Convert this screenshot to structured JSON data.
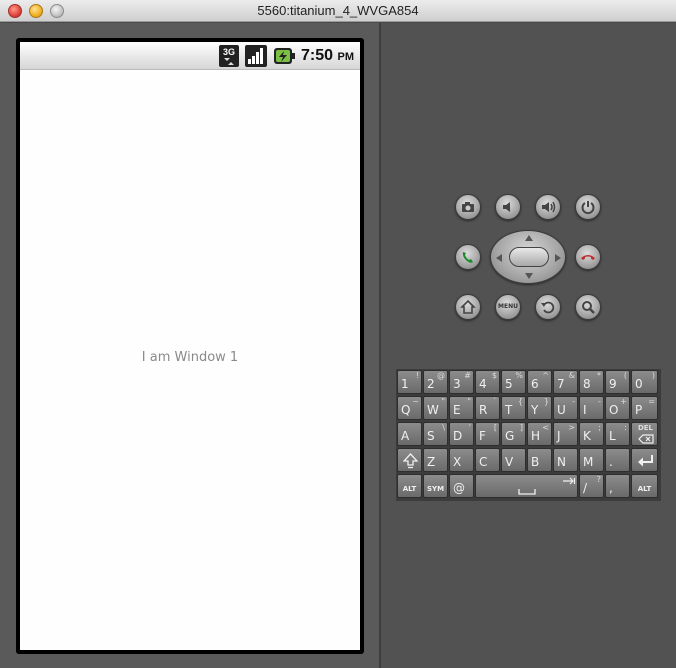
{
  "window": {
    "title": "5560:titanium_4_WVGA854"
  },
  "statusbar": {
    "time": "7:50",
    "ampm": "PM",
    "network": "3G"
  },
  "app": {
    "label": "I am Window 1"
  },
  "controls": {
    "menu_label": "MENU",
    "icons": [
      "camera-icon",
      "volume-down-icon",
      "volume-up-icon",
      "power-icon",
      "call-icon",
      "end-call-icon",
      "home-icon",
      "menu-icon",
      "back-icon",
      "search-icon"
    ]
  },
  "keyboard": {
    "row1": [
      {
        "main": "1",
        "alt": "!"
      },
      {
        "main": "2",
        "alt": "@"
      },
      {
        "main": "3",
        "alt": "#"
      },
      {
        "main": "4",
        "alt": "$"
      },
      {
        "main": "5",
        "alt": "%"
      },
      {
        "main": "6",
        "alt": "^"
      },
      {
        "main": "7",
        "alt": "&"
      },
      {
        "main": "8",
        "alt": "*"
      },
      {
        "main": "9",
        "alt": "("
      },
      {
        "main": "0",
        "alt": ")"
      }
    ],
    "row2": [
      {
        "main": "Q",
        "alt": "~"
      },
      {
        "main": "W",
        "alt": "\""
      },
      {
        "main": "E",
        "alt": "\""
      },
      {
        "main": "R",
        "alt": "`"
      },
      {
        "main": "T",
        "alt": "{"
      },
      {
        "main": "Y",
        "alt": "}"
      },
      {
        "main": "U",
        "alt": "-"
      },
      {
        "main": "I",
        "alt": "-"
      },
      {
        "main": "O",
        "alt": "+"
      },
      {
        "main": "P",
        "alt": "="
      }
    ],
    "row3": [
      {
        "main": "A",
        "alt": ""
      },
      {
        "main": "S",
        "alt": "\\"
      },
      {
        "main": "D",
        "alt": "'"
      },
      {
        "main": "F",
        "alt": "["
      },
      {
        "main": "G",
        "alt": "]"
      },
      {
        "main": "H",
        "alt": "<"
      },
      {
        "main": "J",
        "alt": ">"
      },
      {
        "main": "K",
        "alt": ";"
      },
      {
        "main": "L",
        "alt": ":"
      }
    ],
    "row4": [
      {
        "main": "Z",
        "alt": ""
      },
      {
        "main": "X",
        "alt": ""
      },
      {
        "main": "C",
        "alt": ""
      },
      {
        "main": "V",
        "alt": ""
      },
      {
        "main": "B",
        "alt": ""
      },
      {
        "main": "N",
        "alt": ""
      },
      {
        "main": "M",
        "alt": ""
      },
      {
        "main": ".",
        "alt": ""
      }
    ],
    "del_label": "DEL",
    "alt_label": "ALT",
    "sym_label": "SYM",
    "at_label": "@",
    "slash_main": "/",
    "slash_alt": "?",
    "comma_label": ","
  }
}
